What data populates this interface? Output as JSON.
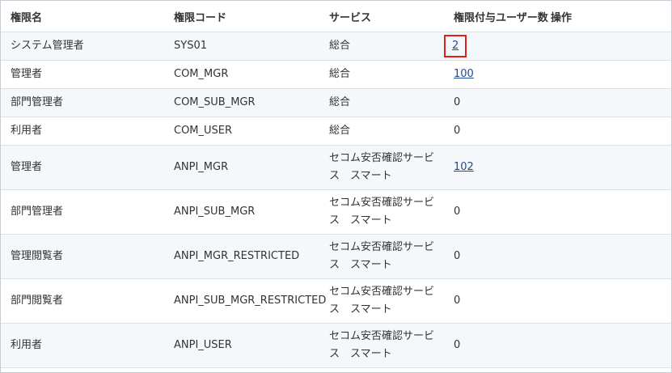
{
  "table": {
    "headers": {
      "name": "権限名",
      "code": "権限コード",
      "service": "サービス",
      "count": "権限付与ユーザー数",
      "ops": "操作"
    },
    "rows": [
      {
        "name": "システム管理者",
        "code": "SYS01",
        "service": "総合",
        "count": "2",
        "count_link": true,
        "highlighted": true
      },
      {
        "name": "管理者",
        "code": "COM_MGR",
        "service": "総合",
        "count": "100",
        "count_link": true
      },
      {
        "name": "部門管理者",
        "code": "COM_SUB_MGR",
        "service": "総合",
        "count": "0",
        "count_link": false
      },
      {
        "name": "利用者",
        "code": "COM_USER",
        "service": "総合",
        "count": "0",
        "count_link": false
      },
      {
        "name": "管理者",
        "code": "ANPI_MGR",
        "service": "セコム安否確認サービス　スマート",
        "count": "102",
        "count_link": true
      },
      {
        "name": "部門管理者",
        "code": "ANPI_SUB_MGR",
        "service": "セコム安否確認サービス　スマート",
        "count": "0",
        "count_link": false
      },
      {
        "name": "管理閲覧者",
        "code": "ANPI_MGR_RESTRICTED",
        "service": "セコム安否確認サービス　スマート",
        "count": "0",
        "count_link": false
      },
      {
        "name": "部門閲覧者",
        "code": "ANPI_SUB_MGR_RESTRICTED",
        "service": "セコム安否確認サービス　スマート",
        "count": "0",
        "count_link": false
      },
      {
        "name": "利用者",
        "code": "ANPI_USER",
        "service": "セコム安否確認サービス　スマート",
        "count": "0",
        "count_link": false
      }
    ]
  },
  "colors": {
    "link": "#1a4b9b",
    "highlight_border": "#e0201a",
    "row_stripe": "#f5f8fb"
  }
}
